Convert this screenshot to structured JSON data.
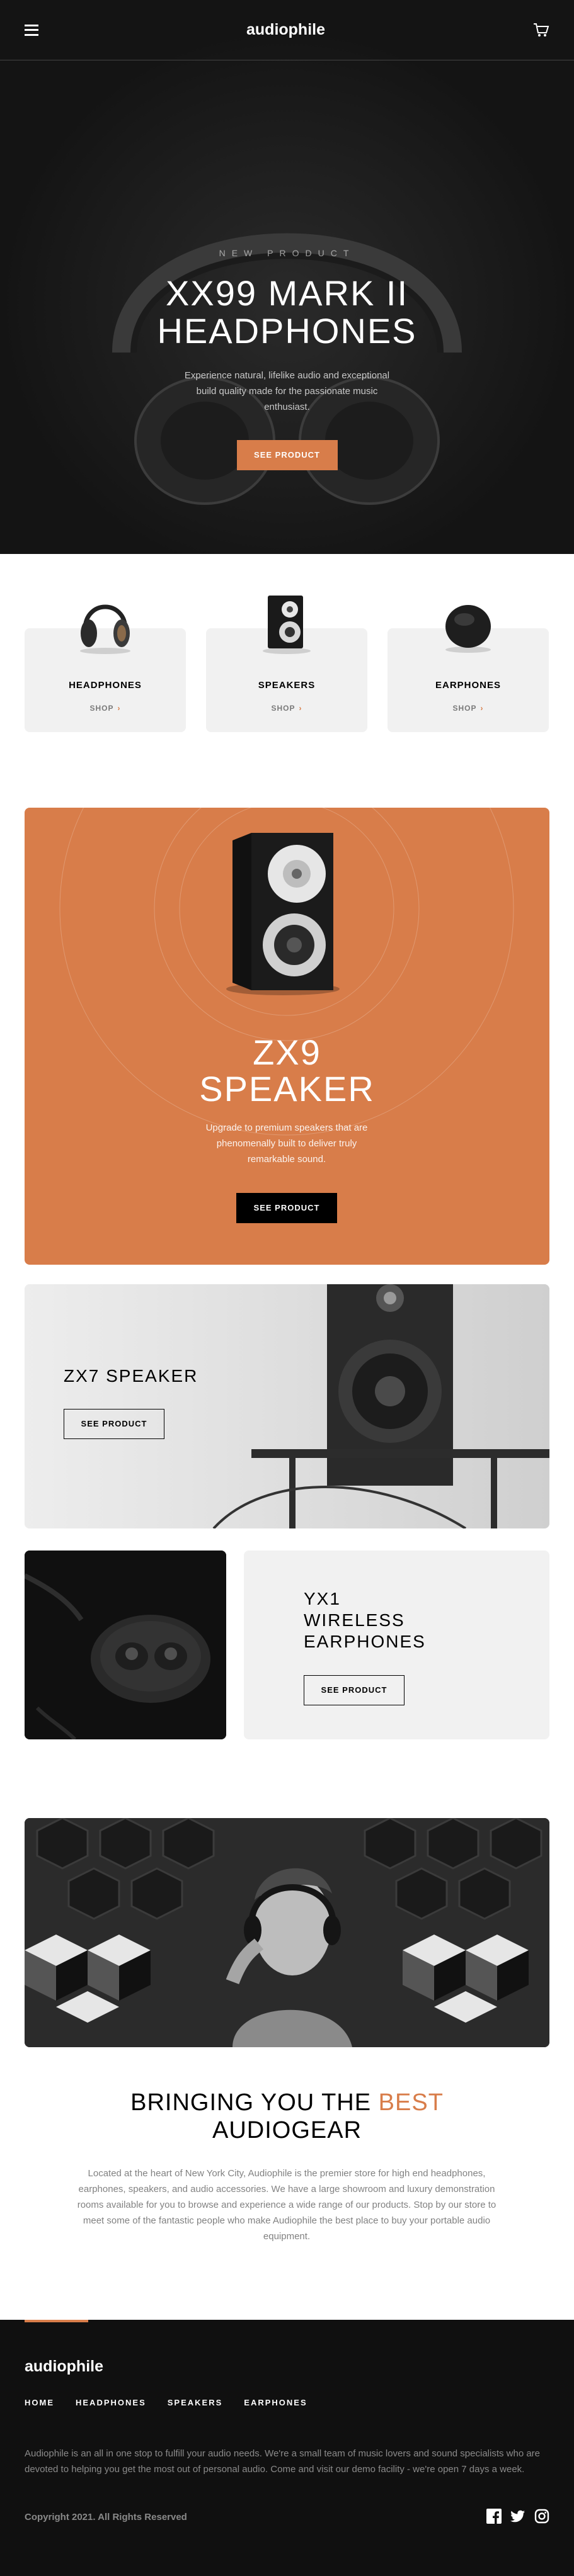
{
  "header": {
    "logo": "audiophile",
    "menu_icon": "hamburger-menu-icon",
    "cart_icon": "shopping-cart-icon"
  },
  "hero": {
    "overline": "NEW PRODUCT",
    "title_line1": "XX99 MARK II",
    "title_line2": "HEADPHONES",
    "description": "Experience natural, lifelike audio and exceptional build quality made for the passionate music enthusiast.",
    "cta": "SEE PRODUCT"
  },
  "categories": [
    {
      "name": "HEADPHONES",
      "shop": "SHOP",
      "icon": "headphones-thumbnail"
    },
    {
      "name": "SPEAKERS",
      "shop": "SHOP",
      "icon": "speaker-thumbnail"
    },
    {
      "name": "EARPHONES",
      "shop": "SHOP",
      "icon": "earphones-thumbnail"
    }
  ],
  "zx9": {
    "title_line1": "ZX9",
    "title_line2": "SPEAKER",
    "description": "Upgrade to premium speakers that are phenomenally built to deliver truly remarkable sound.",
    "cta": "SEE PRODUCT"
  },
  "zx7": {
    "title": "ZX7 SPEAKER",
    "cta": "SEE PRODUCT"
  },
  "yx1": {
    "title_line1": "YX1",
    "title_line2": "WIRELESS",
    "title_line3": "EARPHONES",
    "cta": "SEE PRODUCT"
  },
  "about": {
    "title_part1": "BRINGING YOU THE ",
    "title_accent": "BEST",
    "title_line2": "AUDIOGEAR",
    "description": "Located at the heart of New York City, Audiophile is the premier store for high end headphones, earphones, speakers, and audio accessories. We have a large showroom and luxury demonstration rooms available for you to browse and experience a wide range of our products. Stop by our store to meet some of the fantastic people who make Audiophile the best place to buy your portable audio equipment."
  },
  "footer": {
    "logo": "audiophile",
    "nav": [
      "HOME",
      "HEADPHONES",
      "SPEAKERS",
      "EARPHONES"
    ],
    "description": "Audiophile is an all in one stop to fulfill your audio needs. We're a small team of music lovers and sound specialists who are devoted to helping you get the most out of personal audio. Come and visit our demo facility - we're open 7 days a week.",
    "copyright": "Copyright 2021. All Rights Reserved",
    "socials": [
      "facebook-icon",
      "twitter-icon",
      "instagram-icon"
    ]
  },
  "colors": {
    "accent": "#d87d4a",
    "dark": "#101010",
    "light_gray": "#f1f1f1"
  }
}
